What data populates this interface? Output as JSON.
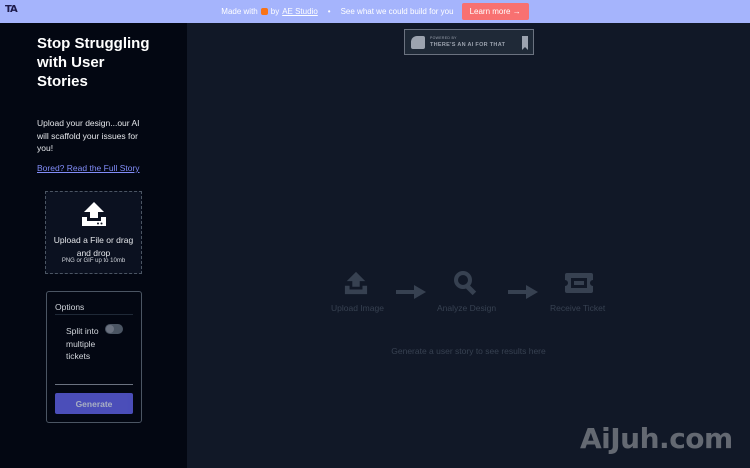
{
  "banner": {
    "logo": "TA",
    "made_with": "Made with",
    "by": "by",
    "studio_link": "AE Studio",
    "separator": "•",
    "pitch": "See what we could build for you",
    "learn_more": "Learn more →"
  },
  "sidebar": {
    "title": "Stop Struggling with User Stories",
    "description": "Upload your design...our AI will scaffold your issues for you!",
    "story_link": "Bored? Read the Full Story",
    "upload": {
      "line1": "Upload a File or drag and drop",
      "line2": "PNG or GIF up to 10mb"
    },
    "options": {
      "header": "Options",
      "split_label": "Split into multiple tickets",
      "split_enabled": false,
      "generate": "Generate"
    }
  },
  "main": {
    "powered_small": "POWERED BY",
    "powered_big": "THERE'S AN AI FOR THAT",
    "steps": [
      "Upload Image",
      "Analyze Design",
      "Receive Ticket"
    ],
    "placeholder": "Generate a user story to see results here"
  },
  "watermark": "AiJuh.com",
  "colors": {
    "banner_bg": "#a5b4fc",
    "learn_more_bg": "#f87171",
    "accent": "#6366f1",
    "link": "#818cf8",
    "sidebar_bg": "#030712",
    "main_bg": "#111827"
  }
}
